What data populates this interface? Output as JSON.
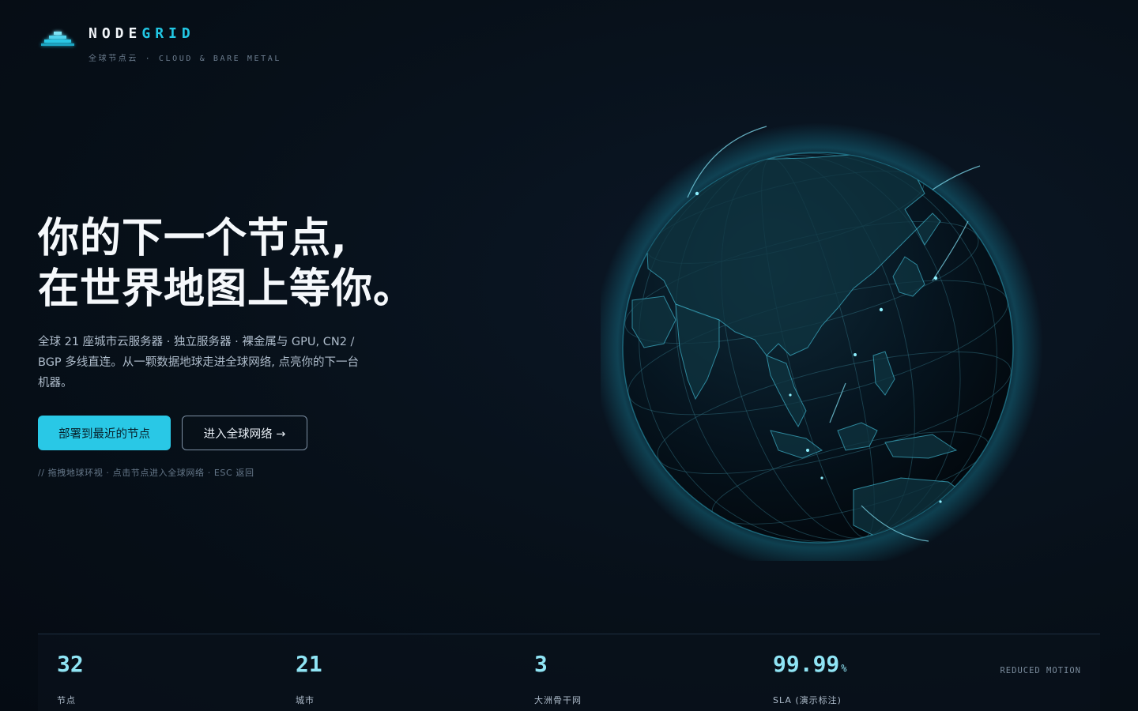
{
  "brand": {
    "name_primary": "NODE",
    "name_accent": "GRID",
    "tagline": "全球节点云 · CLOUD & BARE METAL",
    "logo_icon": "stacked-server-icon"
  },
  "hero": {
    "title_line1": "你的下一个节点,",
    "title_line2": "在世界地图上等你。",
    "description": "全球 21 座城市云服务器 · 独立服务器 · 裸金属与 GPU, CN2 / BGP 多线直连。从一颗数据地球走进全球网络, 点亮你的下一台机器。",
    "primary_button": "部署到最近的节点",
    "secondary_button": "进入全球网络 →",
    "hint": "// 拖拽地球环视 · 点击节点进入全球网络 · ESC 返回"
  },
  "globe": {
    "icon": "earth-globe-icon"
  },
  "stats": [
    {
      "value": "32",
      "unit": "",
      "label": "节点"
    },
    {
      "value": "21",
      "unit": "",
      "label": "城市"
    },
    {
      "value": "3",
      "unit": "",
      "label": "大洲骨干网"
    },
    {
      "value": "99.99",
      "unit": "%",
      "label": "SLA (演示标注)"
    }
  ],
  "reduced_motion_label": "REDUCED MOTION",
  "colors": {
    "accent": "#29c8e6",
    "background": "#060d16",
    "stat_value": "#8fe4f4"
  }
}
